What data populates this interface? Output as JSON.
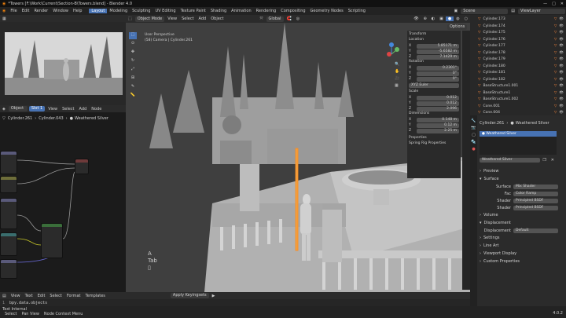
{
  "window": {
    "title": "*Towers [F:\\Work\\Current\\Section-B\\Towers.blend] - Blender 4.0"
  },
  "menu": [
    "File",
    "Edit",
    "Render",
    "Window",
    "Help"
  ],
  "workspaces": [
    "Layout",
    "Modeling",
    "Sculpting",
    "UV Editing",
    "Texture Paint",
    "Shading",
    "Animation",
    "Rendering",
    "Compositing",
    "Geometry Nodes",
    "Scripting"
  ],
  "scene": {
    "scene_label": "Scene",
    "view_layer_label": "ViewLayer"
  },
  "viewport": {
    "mode": "Object Mode",
    "menus": [
      "View",
      "Select",
      "Add",
      "Object"
    ],
    "transform": "Global",
    "info_line1": "User Perspective",
    "info_line2": "(58) Camera | Cylinder.261",
    "key_hint": "A",
    "key_name": "Tab",
    "options_label": "Options"
  },
  "node_editor": {
    "object_label": "Object",
    "slot": "Slot 1",
    "menus": [
      "View",
      "Select",
      "Add",
      "Node"
    ],
    "breadcrumb": [
      "Cylinder.261",
      "Cylinder.043",
      "Weathered Silver"
    ]
  },
  "transform": {
    "header": "Transform",
    "location_label": "Location",
    "location": [
      "5.85171 m",
      "-5.6582 m",
      "7.1429 m"
    ],
    "rotation_label": "Rotation",
    "rotation": [
      "0.2301°",
      "0°",
      "0°"
    ],
    "rotation_mode": "XYZ Euler",
    "scale_label": "Scale",
    "scale": [
      "0.012",
      "0.012",
      "2.096"
    ],
    "dimensions_label": "Dimensions",
    "dimensions": [
      "0.148 m",
      "0.12 m",
      "2.25 m"
    ],
    "properties_label": "Properties",
    "spring_label": "Spring Rig Properties",
    "axes": [
      "X",
      "Y",
      "Z"
    ]
  },
  "outliner": {
    "items": [
      "Cylinder.173",
      "Cylinder.174",
      "Cylinder.175",
      "Cylinder.176",
      "Cylinder.177",
      "Cylinder.178",
      "Cylinder.179",
      "Cylinder.180",
      "Cylinder.181",
      "Cylinder.182",
      "BaseStructure1.001",
      "BaseStructure1",
      "BaseStructure1.002",
      "Cone.001",
      "Cone.004"
    ]
  },
  "material": {
    "breadcrumb": [
      "Cylinder.261",
      "Weathered Silver"
    ],
    "slot_name": "Weathered Silver",
    "material_field": "Weathered Silver",
    "sections": [
      "Preview",
      "Surface",
      "Volume",
      "Displacement",
      "Settings",
      "Line Art",
      "Viewport Display",
      "Custom Properties"
    ],
    "surface_label": "Surface",
    "surface_value": "Mix Shader",
    "fac_label": "Fac",
    "fac_value": "Color Ramp",
    "shader_label": "Shader",
    "shader1": "Principled BSDF",
    "shader2": "Principled BSDF",
    "displacement_label": "Displacement",
    "displacement_value": "Default"
  },
  "text_editor": {
    "menus": [
      "View",
      "Text",
      "Edit",
      "Select",
      "Format",
      "Templates"
    ],
    "line_number": "1",
    "code": "bpy.data.objects",
    "apply_label": "Apply Keyingsets"
  },
  "status": {
    "left": "Text Internal",
    "items": [
      "Select",
      "Pan View",
      "Node Context Menu"
    ],
    "version": "4.0.2"
  }
}
